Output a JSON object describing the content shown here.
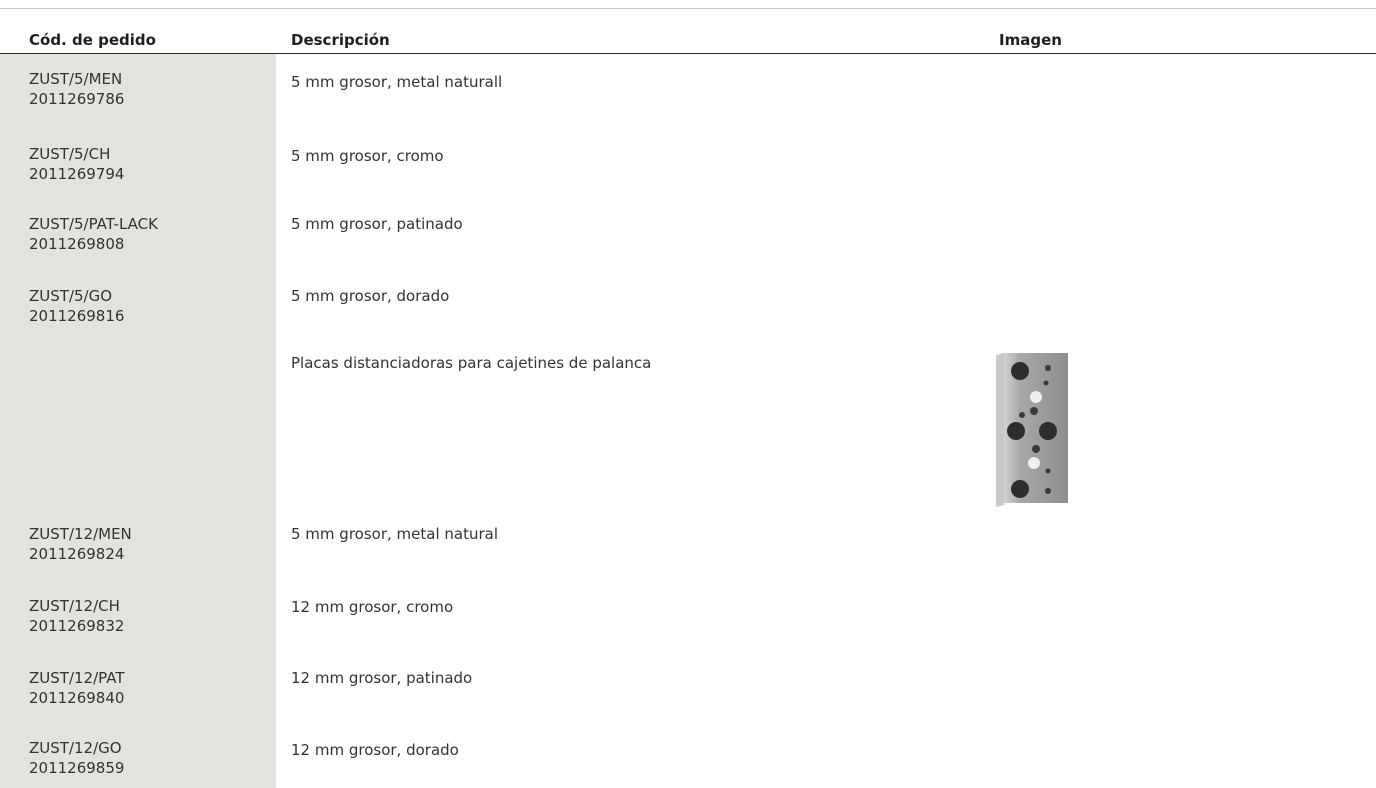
{
  "table": {
    "headers": {
      "code": "Cód. de pedido",
      "description": "Descripción",
      "image": "Imagen"
    },
    "rows": [
      {
        "code": "ZUST/5/MEN",
        "number": "2011269786",
        "description": "5 mm grosor, metal naturall"
      },
      {
        "code": "ZUST/5/CH",
        "number": "2011269794",
        "description": "5 mm grosor, cromo"
      },
      {
        "code": "ZUST/5/PAT-LACK",
        "number": "2011269808",
        "description": "5 mm grosor, patinado"
      },
      {
        "code": "ZUST/5/GO",
        "number": "2011269816",
        "description": "5 mm grosor, dorado"
      },
      {
        "code": "",
        "number": "",
        "description": "Placas distanciadoras para cajetines de palanca",
        "image": "spacer-plate-image"
      },
      {
        "code": "ZUST/12/MEN",
        "number": "2011269824",
        "description": "5 mm grosor, metal natural"
      },
      {
        "code": "ZUST/12/CH",
        "number": "2011269832",
        "description": "12 mm grosor, cromo"
      },
      {
        "code": "ZUST/12/PAT",
        "number": "2011269840",
        "description": "12 mm grosor, patinado"
      },
      {
        "code": "ZUST/12/GO",
        "number": "2011269859",
        "description": "12 mm grosor, dorado"
      }
    ]
  },
  "colors": {
    "code_column_bg": "#e4e2dd",
    "text": "#333333",
    "header_rule": "#2b2b2b"
  }
}
